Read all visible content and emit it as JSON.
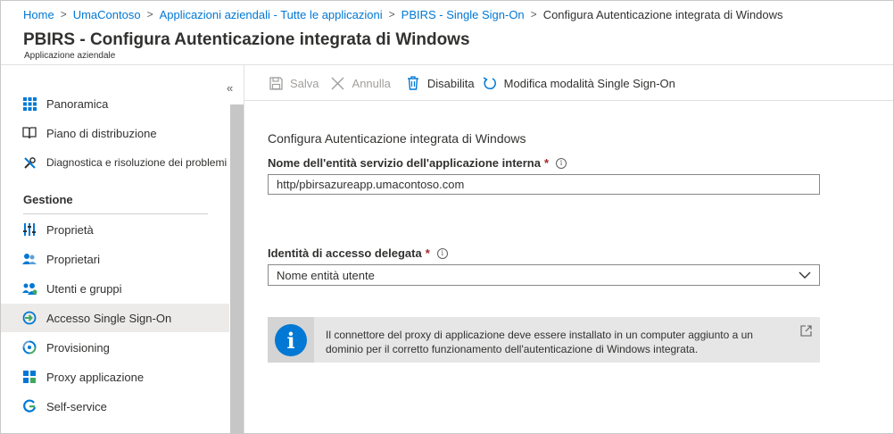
{
  "breadcrumb": {
    "items": [
      "Home",
      "UmaContoso",
      "Applicazioni aziendali - Tutte le applicazioni",
      "PBIRS - Single Sign-On"
    ],
    "current": "Configura Autenticazione integrata di Windows"
  },
  "header": {
    "title": "PBIRS - Configura Autenticazione integrata di Windows",
    "subtitle": "Applicazione aziendale"
  },
  "sidebar": {
    "collapse_glyph": "«",
    "top_items": [
      {
        "label": "Panoramica",
        "icon": "grid-icon"
      },
      {
        "label": "Piano di distribuzione",
        "icon": "book-icon"
      },
      {
        "label": "Diagnostica e risoluzione dei problemi",
        "icon": "wrench-icon"
      }
    ],
    "section_label": "Gestione",
    "manage_items": [
      {
        "label": "Proprietà",
        "icon": "properties-icon"
      },
      {
        "label": "Proprietari",
        "icon": "owners-icon"
      },
      {
        "label": "Utenti e gruppi",
        "icon": "users-groups-icon"
      },
      {
        "label": "Accesso Single Sign-On",
        "icon": "sso-icon",
        "selected": true
      },
      {
        "label": "Provisioning",
        "icon": "provisioning-icon"
      },
      {
        "label": "Proxy applicazione",
        "icon": "app-proxy-icon"
      },
      {
        "label": "Self-service",
        "icon": "self-service-icon"
      }
    ]
  },
  "toolbar": {
    "save_label": "Salva",
    "cancel_label": "Annulla",
    "disable_label": "Disabilita",
    "change_mode_label": "Modifica modalità Single Sign-On"
  },
  "form": {
    "section_title": "Configura Autenticazione integrata di Windows",
    "spn_label": "Nome dell'entità servizio dell'applicazione interna",
    "spn_value": "http/pbirsazureapp.umacontoso.com",
    "delegated_label": "Identità di accesso delegata",
    "delegated_value": "Nome entità utente",
    "required_mark": "*",
    "info_glyph": "i"
  },
  "infobar": {
    "message": "Il connettore del proxy di applicazione deve essere installato in un computer aggiunto a un dominio per il corretto funzionamento dell'autenticazione di Windows integrata.",
    "icon_glyph": "i"
  },
  "colors": {
    "link": "#0078d4",
    "required": "#a4262c",
    "info_icon": "#0078d4",
    "selected_bg": "#edebe9"
  }
}
